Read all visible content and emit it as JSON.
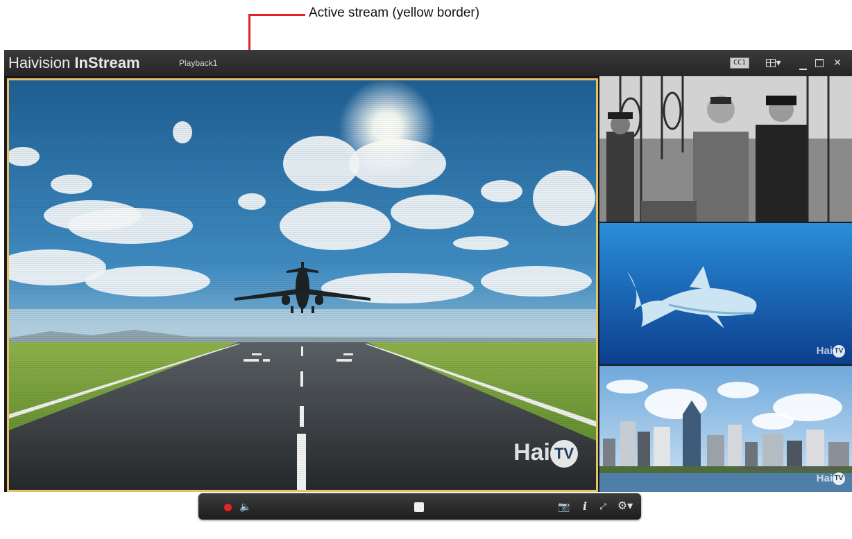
{
  "annotation": {
    "text": "Active stream (yellow border)",
    "color": "#e6202a"
  },
  "titlebar": {
    "brand_light": "Hai",
    "brand_mid": "vision ",
    "brand_bold": "InStream",
    "stream_name": "Playback1",
    "cc_label": "CC1",
    "layout_arrow": "▾",
    "close_glyph": "✕"
  },
  "streams": {
    "active_border_color": "#e3c268",
    "watermark_text": "Hai",
    "watermark_badge": "TV"
  },
  "controls": {
    "volume_glyph": "🔈",
    "snapshot_glyph": "📷",
    "info_glyph": "i",
    "fullscreen_glyph": "⤢",
    "settings_glyph": "⚙▾"
  }
}
